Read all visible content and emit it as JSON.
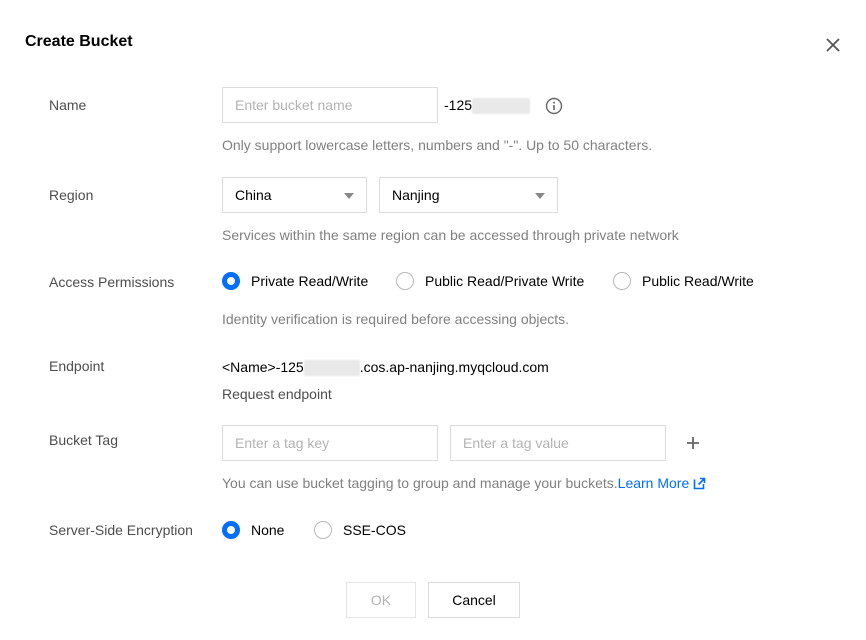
{
  "dialog": {
    "title": "Create Bucket"
  },
  "name": {
    "label": "Name",
    "placeholder": "Enter bucket name",
    "suffix": "-125",
    "help": "Only support lowercase letters, numbers and \"-\". Up to 50 characters."
  },
  "region": {
    "label": "Region",
    "country": "China",
    "city": "Nanjing",
    "help": "Services within the same region can be accessed through private network"
  },
  "access": {
    "label": "Access Permissions",
    "options": [
      "Private Read/Write",
      "Public Read/Private Write",
      "Public Read/Write"
    ],
    "selected": "Private Read/Write",
    "help": "Identity verification is required before accessing objects."
  },
  "endpoint": {
    "label": "Endpoint",
    "prefix": "<Name>-125",
    "suffix": ".cos.ap-nanjing.myqcloud.com",
    "link": "Request endpoint"
  },
  "tag": {
    "label": "Bucket Tag",
    "key_placeholder": "Enter a tag key",
    "value_placeholder": "Enter a tag value",
    "help": "You can use bucket tagging to group and manage your buckets.",
    "learn_more": "Learn More"
  },
  "encryption": {
    "label": "Server-Side Encryption",
    "options": [
      "None",
      "SSE-COS"
    ],
    "selected": "None"
  },
  "buttons": {
    "ok": "OK",
    "cancel": "Cancel"
  },
  "colors": {
    "accent": "#006eff",
    "border": "#dcdcdc",
    "muted": "#808080"
  },
  "icons": {
    "close": "close-icon",
    "info": "info-icon",
    "caret": "chevron-down-icon",
    "plus": "plus-icon",
    "external": "external-link-icon"
  }
}
